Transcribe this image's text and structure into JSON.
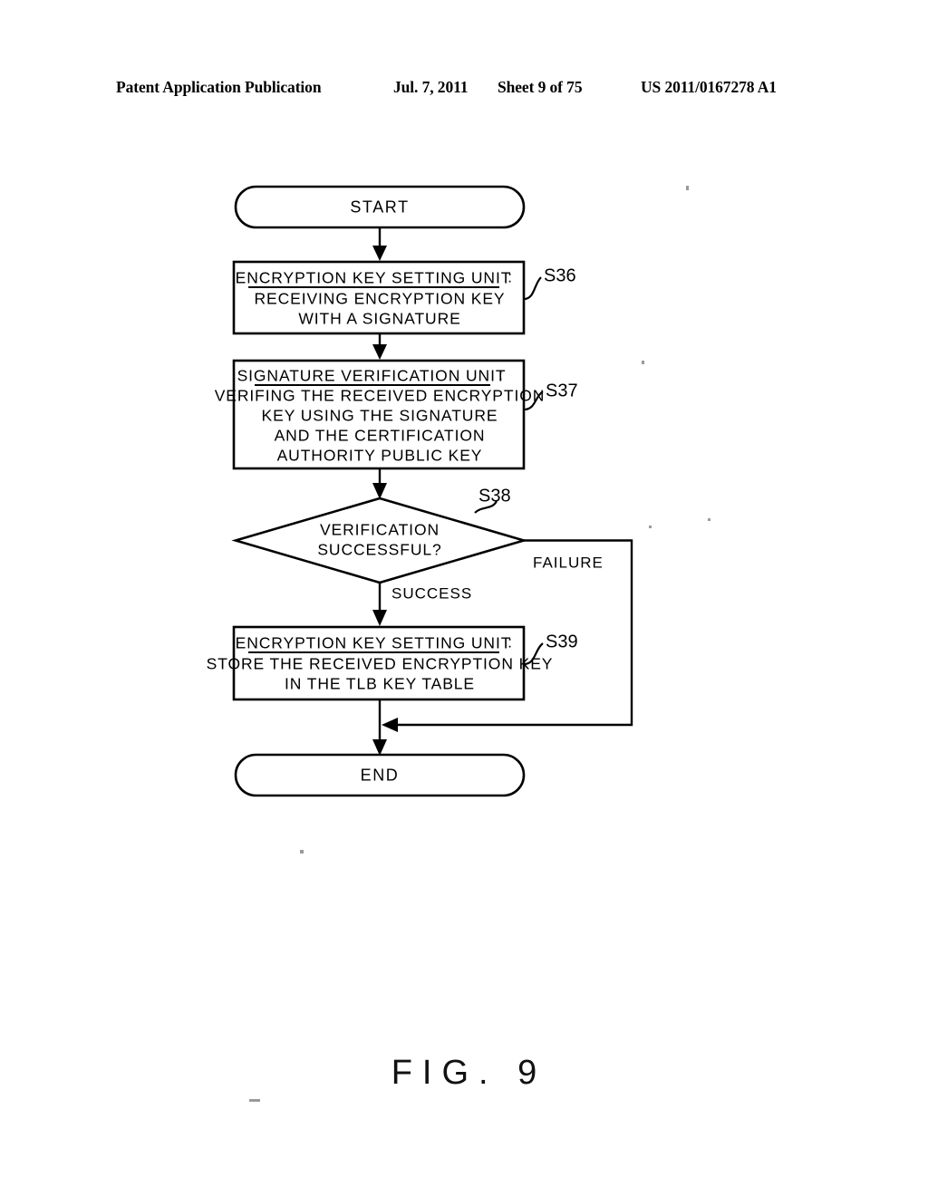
{
  "header": {
    "publication": "Patent Application Publication",
    "date": "Jul. 7, 2011",
    "sheet": "Sheet 9 of 75",
    "number": "US 2011/0167278 A1"
  },
  "figure": {
    "caption": "FIG. 9"
  },
  "flowchart": {
    "start": {
      "label": "START"
    },
    "end": {
      "label": "END"
    },
    "steps": [
      {
        "id": "S36",
        "title": "ENCRYPTION KEY SETTING UNIT",
        "colon": ":",
        "body": [
          "RECEIVING ENCRYPTION KEY",
          "WITH A SIGNATURE"
        ]
      },
      {
        "id": "S37",
        "title": "SIGNATURE VERIFICATION UNIT",
        "colon": ":",
        "body": [
          "VERIFING THE RECEIVED ENCRYPTION",
          "KEY USING THE SIGNATURE",
          "AND THE CERTIFICATION",
          "AUTHORITY PUBLIC KEY"
        ]
      },
      {
        "id": "S39",
        "title": "ENCRYPTION KEY SETTING UNIT",
        "colon": ":",
        "body": [
          "STORE THE RECEIVED ENCRYPTION KEY",
          "IN THE TLB KEY TABLE"
        ]
      }
    ],
    "decision": {
      "id": "S38",
      "lines": [
        "VERIFICATION",
        "SUCCESSFUL?"
      ],
      "branch_yes": "SUCCESS",
      "branch_no": "FAILURE"
    }
  },
  "colors": {
    "ink": "#000000",
    "paper": "#ffffff"
  }
}
